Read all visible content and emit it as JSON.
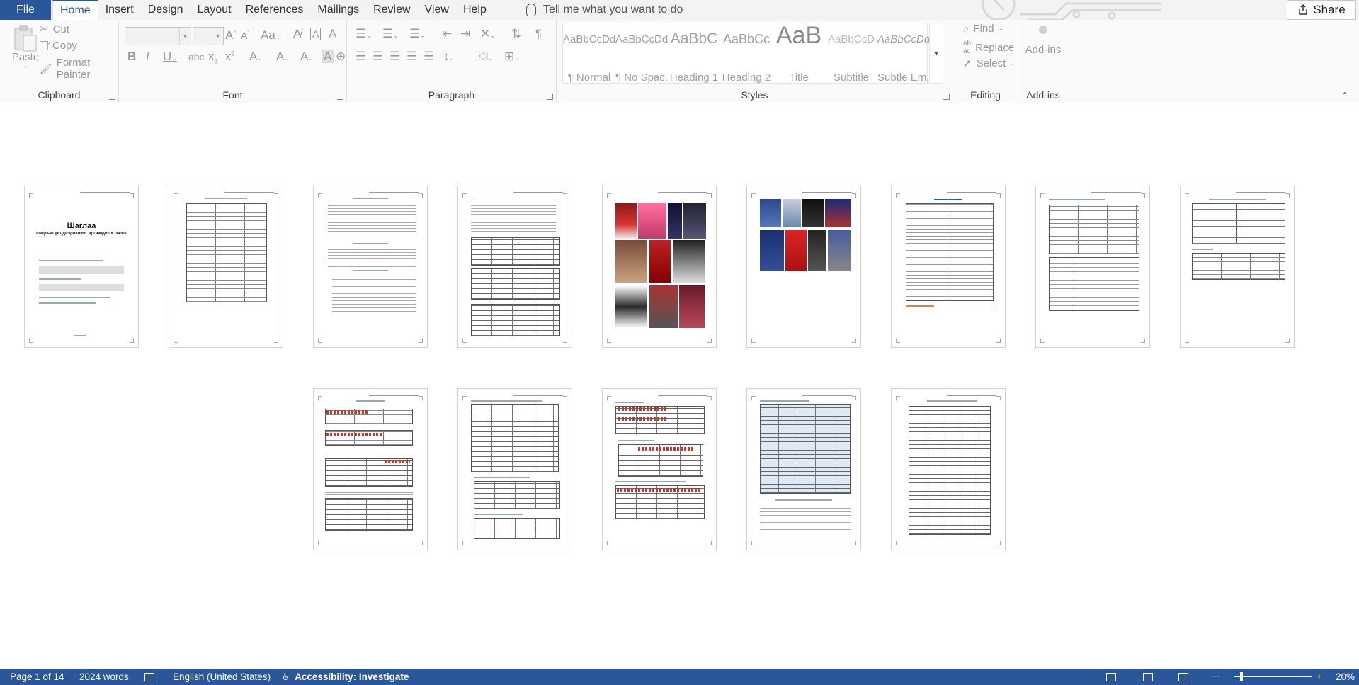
{
  "tabs": {
    "file": "File",
    "items": [
      "Home",
      "Insert",
      "Design",
      "Layout",
      "References",
      "Mailings",
      "Review",
      "View",
      "Help"
    ],
    "active": "Home",
    "tell_me": "Tell me what you want to do",
    "share": "Share"
  },
  "ribbon": {
    "clipboard": {
      "label": "Clipboard",
      "paste": "Paste",
      "cut": "Cut",
      "copy": "Copy",
      "format_painter": "Format Painter"
    },
    "font": {
      "label": "Font"
    },
    "paragraph": {
      "label": "Paragraph"
    },
    "styles": {
      "label": "Styles",
      "items": [
        {
          "preview": "AaBbCcDd",
          "name": "¶ Normal"
        },
        {
          "preview": "AaBbCcDd",
          "name": "¶ No Spac..."
        },
        {
          "preview": "AaBbC",
          "name": "Heading 1"
        },
        {
          "preview": "AaBbCc",
          "name": "Heading 2"
        },
        {
          "preview": "AaB",
          "name": "Title"
        },
        {
          "preview": "AaBbCcD",
          "name": "Subtitle"
        },
        {
          "preview": "AaBbCcDd",
          "name": "Subtle Em..."
        }
      ]
    },
    "editing": {
      "label": "Editing",
      "find": "Find",
      "replace": "Replace",
      "select": "Select"
    },
    "addins": {
      "label": "Add-ins",
      "button": "Add-ins"
    }
  },
  "document": {
    "page1_title": "Шаглаа",
    "page1_subtitle": "Оёдлын үйлдвэрлэлийг өргөжүүлэх төсөл"
  },
  "status": {
    "page": "Page 1 of 14",
    "words": "2024 words",
    "language": "English (United States)",
    "accessibility": "Accessibility: Investigate",
    "zoom": "20%",
    "zoom_level": 0.2
  },
  "colors": {
    "accent": "#2b579a"
  }
}
